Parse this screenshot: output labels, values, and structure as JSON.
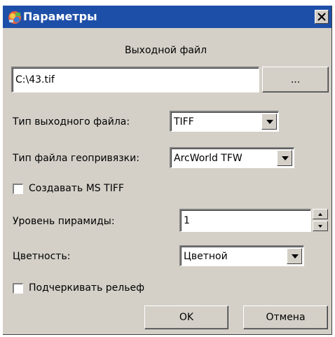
{
  "window": {
    "title": "Параметры",
    "icon": "colorful-parameters-icon",
    "close_icon": "close-icon"
  },
  "output_section": {
    "heading": "Выходной файл",
    "path_value": "C:\\43.tif",
    "browse_label": "..."
  },
  "fields": {
    "file_type": {
      "label": "Тип выходного файла:",
      "value": "TIFF"
    },
    "georef_type": {
      "label": "Тип файла геопривязки:",
      "value": "ArcWorld TFW"
    },
    "create_ms_tiff": {
      "label": "Создавать MS TIFF",
      "checked": false
    },
    "pyramid_level": {
      "label": "Уровень пирамиды:",
      "value": "1"
    },
    "color_mode": {
      "label": "Цветность:",
      "value": "Цветной"
    },
    "emphasize_relief": {
      "label": "Подчеркивать рельеф",
      "checked": false
    }
  },
  "buttons": {
    "ok": "OK",
    "cancel": "Отмена"
  },
  "colors": {
    "titlebar": "#1e4fa8",
    "dialog_face": "#d4d0c8"
  }
}
